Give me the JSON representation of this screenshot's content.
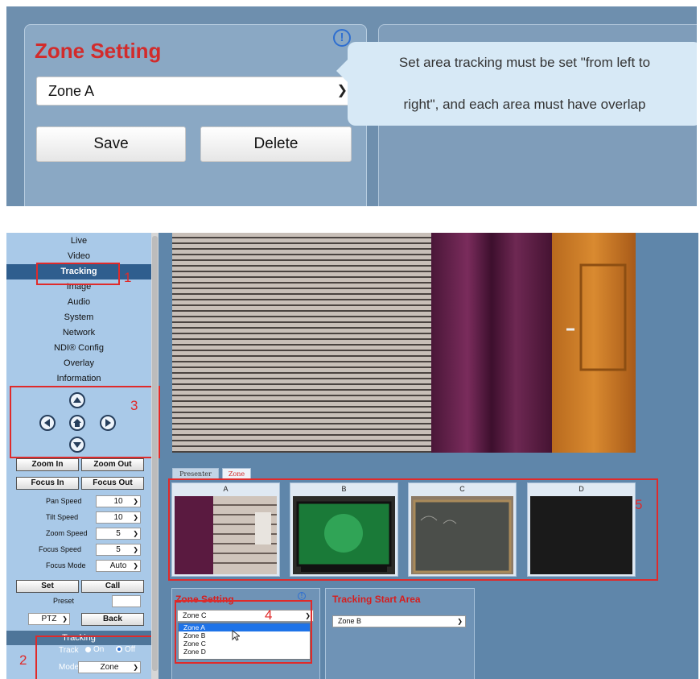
{
  "top": {
    "title": "Zone Setting",
    "info_icon": "info-circle-icon",
    "info_glyph": "!",
    "selected_zone": "Zone A",
    "save_label": "Save",
    "delete_label": "Delete",
    "tooltip_line1": "Set area tracking must be set \"from left to",
    "tooltip_line2": "right\", and each area must have overlap"
  },
  "sidebar": {
    "nav": [
      "Live",
      "Video",
      "Tracking",
      "Image",
      "Audio",
      "System",
      "Network",
      "NDI® Config",
      "Overlay",
      "Information"
    ],
    "active": "Tracking",
    "zoom_in": "Zoom In",
    "zoom_out": "Zoom Out",
    "focus_in": "Focus In",
    "focus_out": "Focus Out",
    "speeds": [
      {
        "label": "Pan Speed",
        "value": "10"
      },
      {
        "label": "Tilt Speed",
        "value": "10"
      },
      {
        "label": "Zoom Speed",
        "value": "5"
      },
      {
        "label": "Focus Speed",
        "value": "5"
      },
      {
        "label": "Focus Mode",
        "value": "Auto"
      }
    ],
    "set_label": "Set",
    "call_label": "Call",
    "preset_label": "Preset",
    "ptz_value": "PTZ",
    "back_label": "Back",
    "tracking_section": "Tracking",
    "track_label": "Track",
    "track_on": "On",
    "track_off": "Off",
    "track_state": "Off",
    "mode_label": "Mode",
    "mode_value": "Zone"
  },
  "annotations": [
    "1",
    "2",
    "3",
    "4",
    "5"
  ],
  "tabs": {
    "presenter": "Presenter",
    "zone": "Zone"
  },
  "zones": [
    {
      "label": "A"
    },
    {
      "label": "B"
    },
    {
      "label": "C"
    },
    {
      "label": "D"
    }
  ],
  "zone_setting": {
    "title": "Zone Setting",
    "selected": "Zone C",
    "options": [
      "Zone A",
      "Zone B",
      "Zone C",
      "Zone D"
    ],
    "highlighted": "Zone A"
  },
  "tracking_start": {
    "title": "Tracking Start Area",
    "selected": "Zone B"
  },
  "colors": {
    "annotation_red": "#e02a2a",
    "title_red": "#d22b2b",
    "active_nav": "#2f5e8e",
    "dropdown_highlight": "#1e73e8"
  }
}
